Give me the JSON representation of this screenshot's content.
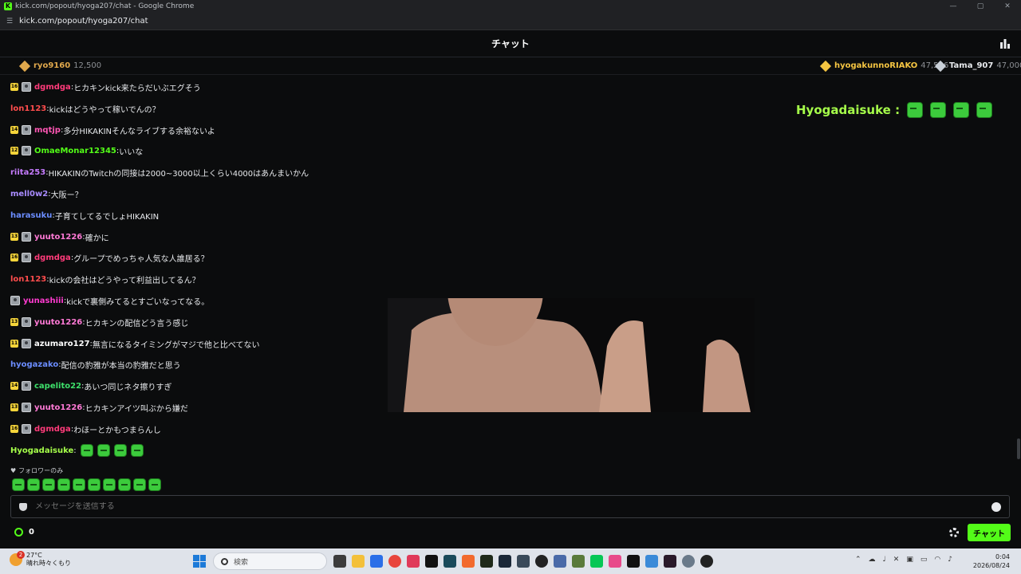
{
  "browser": {
    "window_title": "kick.com/popout/hyoga207/chat - Google Chrome",
    "favicon_letter": "K",
    "url": "kick.com/popout/hyoga207/chat",
    "controls": [
      "—",
      "▢",
      "✕"
    ]
  },
  "chat": {
    "title": "チャット"
  },
  "leaderboard": [
    {
      "name": "ryo9160",
      "points": "12,500",
      "color": "#e0a84c"
    },
    {
      "name": "hyogakunnoRIAKO",
      "points": "47,566",
      "color": "#f5c542"
    },
    {
      "name": "Tama_907",
      "points": "47,000",
      "color": "#c9d0d8"
    }
  ],
  "messages": [
    {
      "badge": "16",
      "avatar": true,
      "user": "dgmdga",
      "color": "#ff3b7a",
      "text": "ヒカキンkick来たらだいぶエグそう"
    },
    {
      "badge": "",
      "avatar": false,
      "user": "lon1123",
      "color": "#ff4d4d",
      "text": "kickはどうやって稼いでんの？"
    },
    {
      "badge": "14",
      "avatar": true,
      "user": "mqtjp",
      "color": "#ff56b4",
      "text": "多分HIKAKINそんなライブする余裕ないよ"
    },
    {
      "badge": "12",
      "avatar": true,
      "user": "OmaeMonar12345",
      "color": "#53fc18",
      "text": "いいな"
    },
    {
      "badge": "",
      "avatar": false,
      "user": "riita253",
      "color": "#c67cff",
      "text": "HIKAKINのTwitchの同接は2000~3000以上くらい4000はあんまいかん"
    },
    {
      "badge": "",
      "avatar": false,
      "user": "mell0w2",
      "color": "#a98cff",
      "text": "大阪ー？"
    },
    {
      "badge": "",
      "avatar": false,
      "user": "harasuku",
      "color": "#6b8dff",
      "text": "子育てしてるでしょHIKAKIN"
    },
    {
      "badge": "13",
      "avatar": true,
      "user": "yuuto1226",
      "color": "#ff7ad6",
      "text": "確かに"
    },
    {
      "badge": "16",
      "avatar": true,
      "user": "dgmdga",
      "color": "#ff3b7a",
      "text": "グループでめっちゃ人気な人誰居る？"
    },
    {
      "badge": "",
      "avatar": false,
      "user": "lon1123",
      "color": "#ff4d4d",
      "text": "kickの会社はどうやって利益出してるん？"
    },
    {
      "badge": "",
      "avatar": true,
      "user": "yunashiii",
      "color": "#ff3bd0",
      "text": "kickで裏側みてるとすごいなってなる。"
    },
    {
      "badge": "13",
      "avatar": true,
      "user": "yuuto1226",
      "color": "#ff7ad6",
      "text": "ヒカキンの配信どう言う感じ"
    },
    {
      "badge": "11",
      "avatar": true,
      "user": "azumaro127",
      "color": "#ffffff",
      "text": "無言になるタイミングがマジで他と比べてない"
    },
    {
      "badge": "",
      "avatar": false,
      "user": "hyogazako",
      "color": "#6b8dff",
      "text": "配信の豹雅が本当の豹雅だと思う"
    },
    {
      "badge": "14",
      "avatar": true,
      "user": "capelito22",
      "color": "#3ee06b",
      "text": "あいつ同じネタ擦りすぎ"
    },
    {
      "badge": "13",
      "avatar": true,
      "user": "yuuto1226",
      "color": "#ff7ad6",
      "text": "ヒカキンアイツ叫ぶから嫌だ"
    },
    {
      "badge": "16",
      "avatar": true,
      "user": "dgmdga",
      "color": "#ff3b7a",
      "text": "わほーとかもつまらんし"
    }
  ],
  "last_message": {
    "user": "Hyogadaisuke",
    "color": "#a6ff4a",
    "emote_count": 4
  },
  "overlay": {
    "text": "Hyogadaisuke :",
    "emote_count": 4
  },
  "followers_only": "フォロワーのみ",
  "emote_tray_count": 10,
  "input": {
    "placeholder": "メッセージを送信する"
  },
  "footer": {
    "points": "0",
    "send_label": "チャット"
  },
  "taskbar": {
    "weather_alert": "2",
    "temperature": "27°C",
    "forecast": "晴れ時々くもり",
    "search_placeholder": "検索",
    "time": "0:04",
    "date": "2026/08/24"
  },
  "colors": {
    "accent": "#53fc18",
    "background": "#0b0c0d"
  }
}
